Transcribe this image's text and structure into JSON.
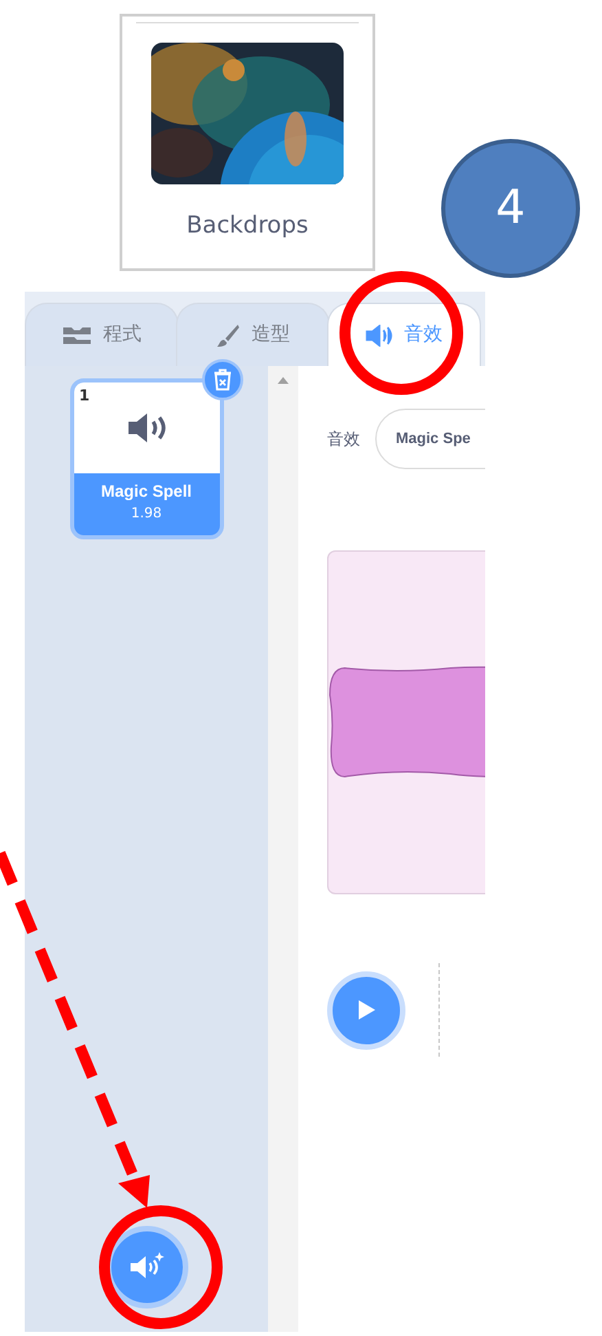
{
  "backdrops": {
    "label": "Backdrops"
  },
  "step_badge": {
    "label": "4"
  },
  "tabs": [
    {
      "kind": "code",
      "label": "程式",
      "selected": false
    },
    {
      "kind": "costume",
      "label": "造型",
      "selected": false
    },
    {
      "kind": "sound",
      "label": "音效",
      "selected": true
    }
  ],
  "sounds": [
    {
      "index": "1",
      "name": "Magic Spell",
      "duration": "1.98",
      "selected": true
    }
  ],
  "editor": {
    "sound_label": "音效",
    "sound_name": "Magic Spe"
  }
}
